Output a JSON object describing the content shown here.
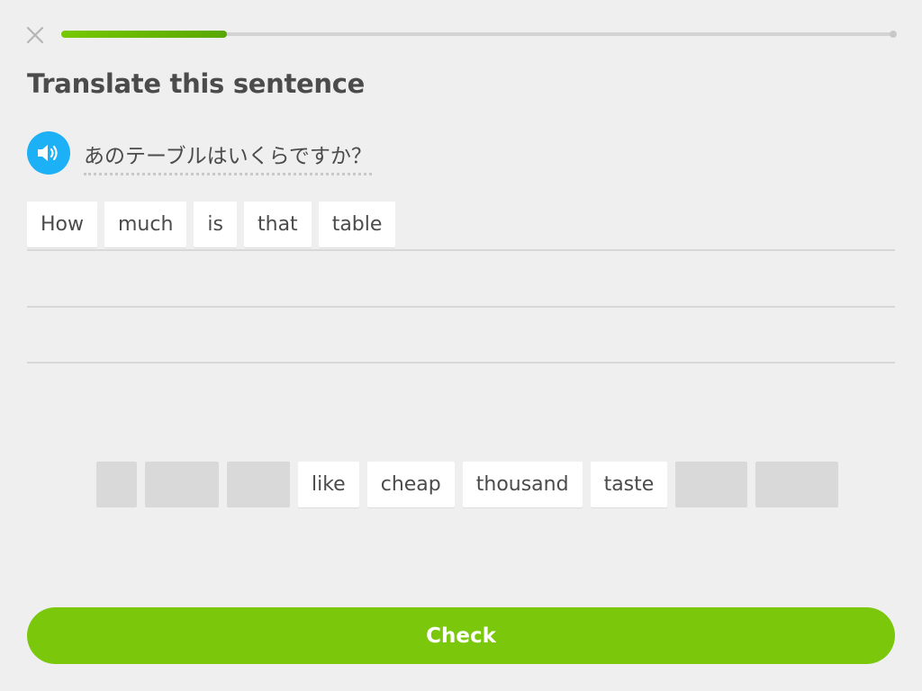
{
  "header": {
    "close_icon": "close-icon",
    "progress": 0.2
  },
  "title": "Translate this sentence",
  "prompt": {
    "speaker_icon": "speaker-icon",
    "text": "あのテーブルはいくらですか？"
  },
  "answer": {
    "tiles": [
      "How",
      "much",
      "is",
      "that",
      "table"
    ]
  },
  "word_bank": {
    "tiles": [
      "",
      "",
      "",
      "like",
      "cheap",
      "thousand",
      "taste",
      "",
      ""
    ]
  },
  "check_button": {
    "label": "Check"
  },
  "colors": {
    "accent_green": "#7ac70c",
    "progress_green": "#58a700",
    "speaker_blue": "#1cb0f6",
    "background": "#efefef"
  }
}
